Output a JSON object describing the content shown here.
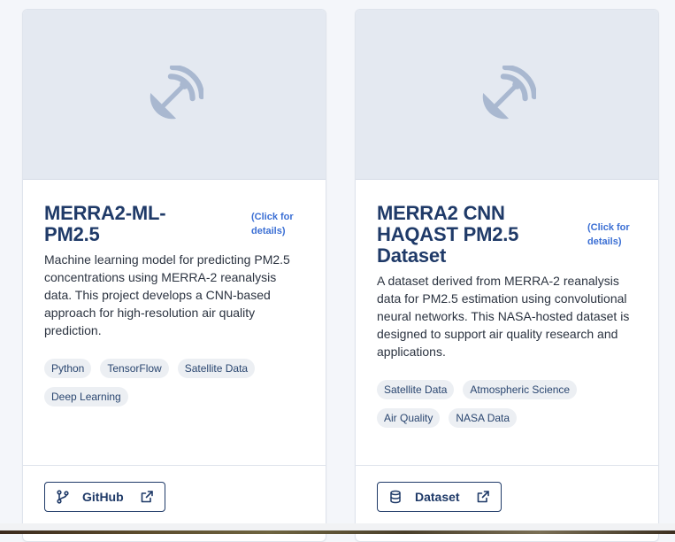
{
  "cards": [
    {
      "title": "MERRA2-ML-PM2.5",
      "click_hint": "(Click for details)",
      "description": "Machine learning model for predicting PM2.5 concentrations using MERRA-2 reanalysis data. This project develops a CNN-based approach for high-resolution air quality prediction.",
      "tags": [
        "Python",
        "TensorFlow",
        "Satellite Data",
        "Deep Learning"
      ],
      "link": {
        "label": "GitHub",
        "icon": "git-branch-icon"
      },
      "image_icon": "satellite-dish-icon"
    },
    {
      "title": "MERRA2 CNN HAQAST PM2.5 Dataset",
      "click_hint": "(Click for details)",
      "description": "A dataset derived from MERRA-2 reanalysis data for PM2.5 estimation using convolutional neural networks. This NASA-hosted dataset is designed to support air quality research and applications.",
      "tags": [
        "Satellite Data",
        "Atmospheric Science",
        "Air Quality",
        "NASA Data"
      ],
      "link": {
        "label": "Dataset",
        "icon": "database-icon"
      },
      "image_icon": "satellite-dish-icon"
    }
  ],
  "colors": {
    "title": "#1f3a68",
    "hint": "#3b6fd4",
    "image_bg": "#e4e9f1",
    "icon": "#a9b8d0",
    "tag_bg": "#eceff3"
  }
}
